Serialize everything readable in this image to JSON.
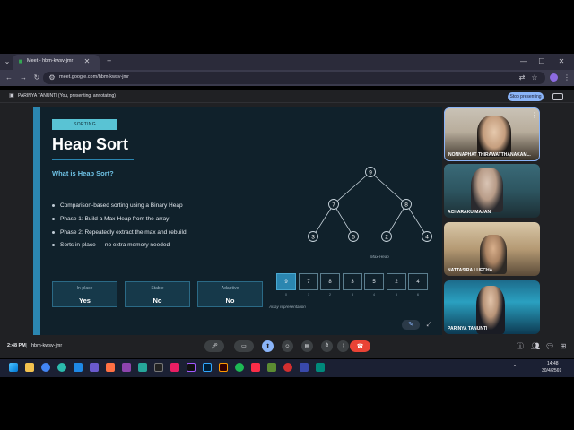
{
  "browser": {
    "tab_title": "Meet - hbm-kwsv-jmr",
    "new_tab": "+",
    "url": "meet.google.com/hbm-kwsv-jmr"
  },
  "infobar": {
    "presenter_text": "PARINYA TANUNTI (You, presenting, annotating)",
    "stop_label": "Stop presenting"
  },
  "slide": {
    "badge": "SORTING",
    "title": "Heap Sort",
    "subtitle": "What is Heap Sort?",
    "bullets": [
      "Comparison-based sorting using a Binary Heap",
      "Phase 1: Build a Max-Heap from the array",
      "Phase 2: Repeatedly extract the max and rebuild",
      "Sorts in-place — no extra memory needed"
    ],
    "stats": [
      {
        "label": "In-place",
        "value": "Yes"
      },
      {
        "label": "Stable",
        "value": "No"
      },
      {
        "label": "Adaptive",
        "value": "No"
      }
    ],
    "heap_nodes": [
      "9",
      "7",
      "8",
      "3",
      "5",
      "2",
      "4"
    ],
    "heap_caption": "Max-Heap",
    "array_values": [
      "9",
      "7",
      "8",
      "3",
      "5",
      "2",
      "4"
    ],
    "array_indices": [
      "0",
      "1",
      "2",
      "3",
      "4",
      "5",
      "6"
    ],
    "array_caption": "Array representation"
  },
  "participants": [
    {
      "name": "NONNAPHAT THIRAWATTHANAKAM..."
    },
    {
      "name": "ACHARAKU MAJAN"
    },
    {
      "name": "NATTASIRA LUECHA"
    },
    {
      "name": "PARINYA TANUNTI"
    }
  ],
  "meeting": {
    "time": "2:48 PM",
    "code": "hbm-kwsv-jmr"
  },
  "taskbar": {
    "clock_time": "14:48",
    "clock_date": "30/4/2569"
  },
  "colors": {
    "slide_bg": "#10212b",
    "accent": "#2b86b0",
    "badge": "#59c3d4",
    "end_call": "#ea4335",
    "present_highlight": "#8ab4f8"
  }
}
